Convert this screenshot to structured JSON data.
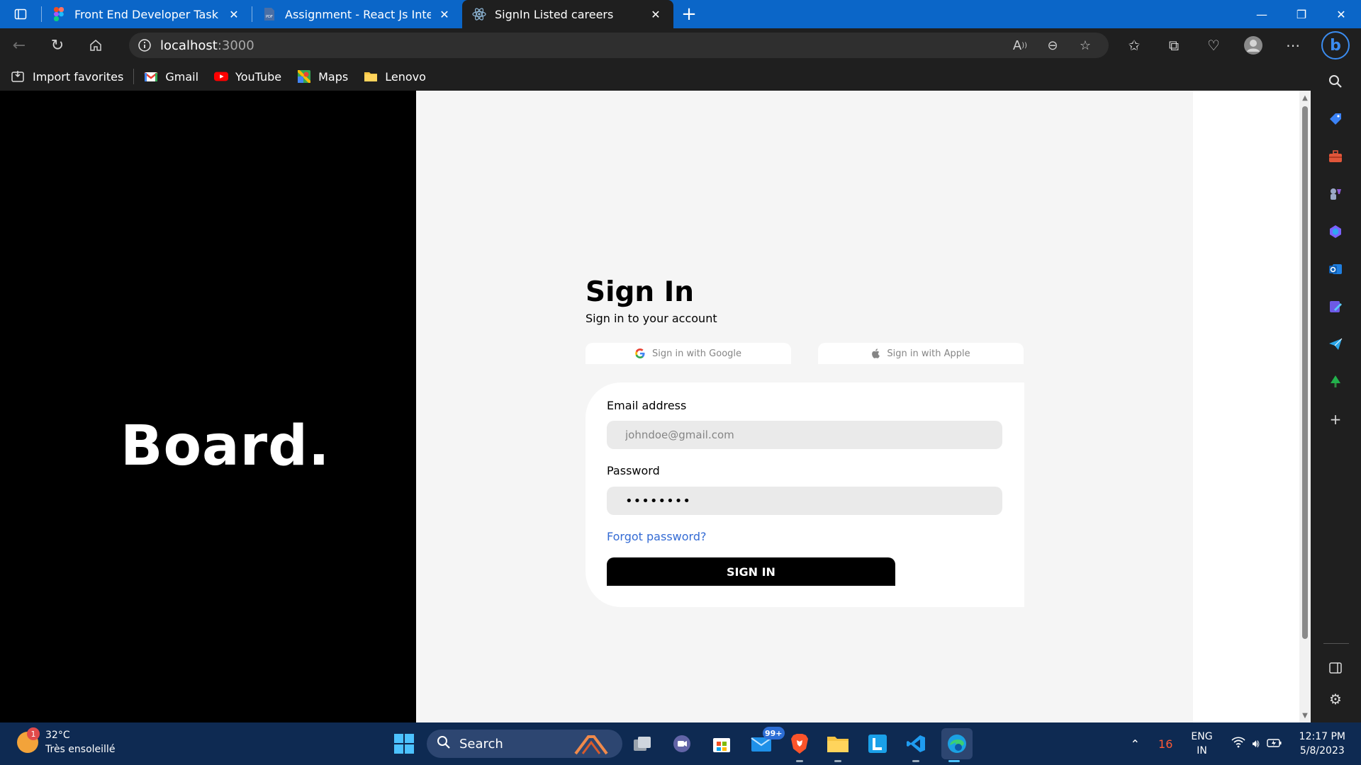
{
  "browser": {
    "tabs": [
      {
        "label": "Front End Developer Task – Figm",
        "favicon": "figma-icon"
      },
      {
        "label": "Assignment - React Js Intern.pdf",
        "favicon": "pdf-icon"
      },
      {
        "label": "SignIn Listed careers",
        "favicon": "react-icon",
        "active": true
      }
    ],
    "url": {
      "host": "localhost",
      "port": ":3000"
    },
    "favorites": [
      {
        "label": "Import favorites"
      },
      {
        "label": "Gmail"
      },
      {
        "label": "YouTube"
      },
      {
        "label": "Maps"
      },
      {
        "label": "Lenovo"
      }
    ]
  },
  "page": {
    "logo": "Board.",
    "title": "Sign In",
    "subtitle": "Sign in to your account",
    "google_btn": "Sign in with Google",
    "apple_btn": "Sign in with Apple",
    "email_label": "Email address",
    "email_placeholder": "johndoe@gmail.com",
    "password_label": "Password",
    "password_value": "password",
    "forgot": "Forgot password?",
    "submit": "SIGN IN"
  },
  "taskbar": {
    "weather_temp": "32°C",
    "weather_desc": "Très ensoleillé",
    "weather_badge": "1",
    "search": "Search",
    "mail_badge": "99+",
    "tray_num": "16",
    "lang_1": "ENG",
    "lang_2": "IN",
    "time": "12:17 PM",
    "date": "5/8/2023"
  },
  "colors": {
    "tabbar": "#0b66c8",
    "chrome": "#1f1f1f",
    "link": "#346bd4",
    "page_bg": "#f5f5f5",
    "taskbar": "#0e2a52"
  }
}
